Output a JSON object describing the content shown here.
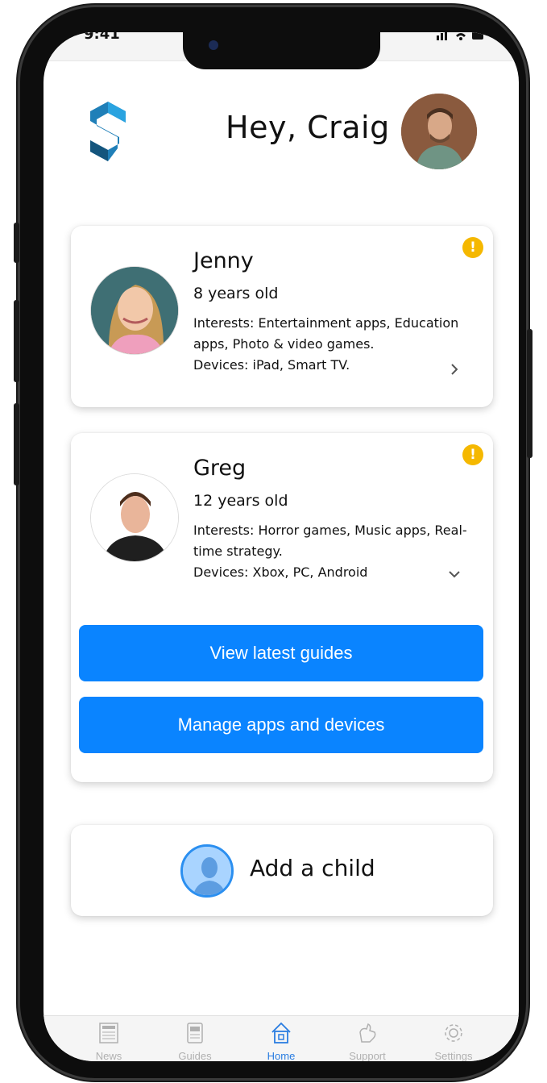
{
  "status_bar": {
    "time": "9:41",
    "icons": [
      "signal-icon",
      "wifi-icon",
      "battery-icon"
    ]
  },
  "header": {
    "greeting": "Hey, Craig"
  },
  "children": [
    {
      "name": "Jenny",
      "age": "8 years old",
      "interests": "Interests: Entertainment apps, Education apps, Photo & video games.",
      "devices": "Devices: iPad, Smart TV.",
      "alert": "!",
      "expanded": false
    },
    {
      "name": "Greg",
      "age": "12 years old",
      "interests": "Interests: Horror games, Music apps, Real-time strategy.",
      "devices": "Devices: Xbox, PC, Android",
      "alert": "!",
      "expanded": true,
      "actions": [
        "View latest guides",
        "Manage apps and devices"
      ]
    }
  ],
  "add_child": {
    "label": "Add a child"
  },
  "tabbar": {
    "tabs": [
      {
        "label": "News",
        "icon": "newspaper-icon",
        "active": false
      },
      {
        "label": "Guides",
        "icon": "guides-icon",
        "active": false
      },
      {
        "label": "Home",
        "icon": "home-icon",
        "active": true
      },
      {
        "label": "Support",
        "icon": "support-icon",
        "active": false
      },
      {
        "label": "Settings",
        "icon": "gear-icon",
        "active": false
      }
    ]
  },
  "colors": {
    "primary": "#0a84ff",
    "alert": "#f5b800",
    "active_tab": "#2a7de1",
    "logo": "#1f7fb8"
  }
}
